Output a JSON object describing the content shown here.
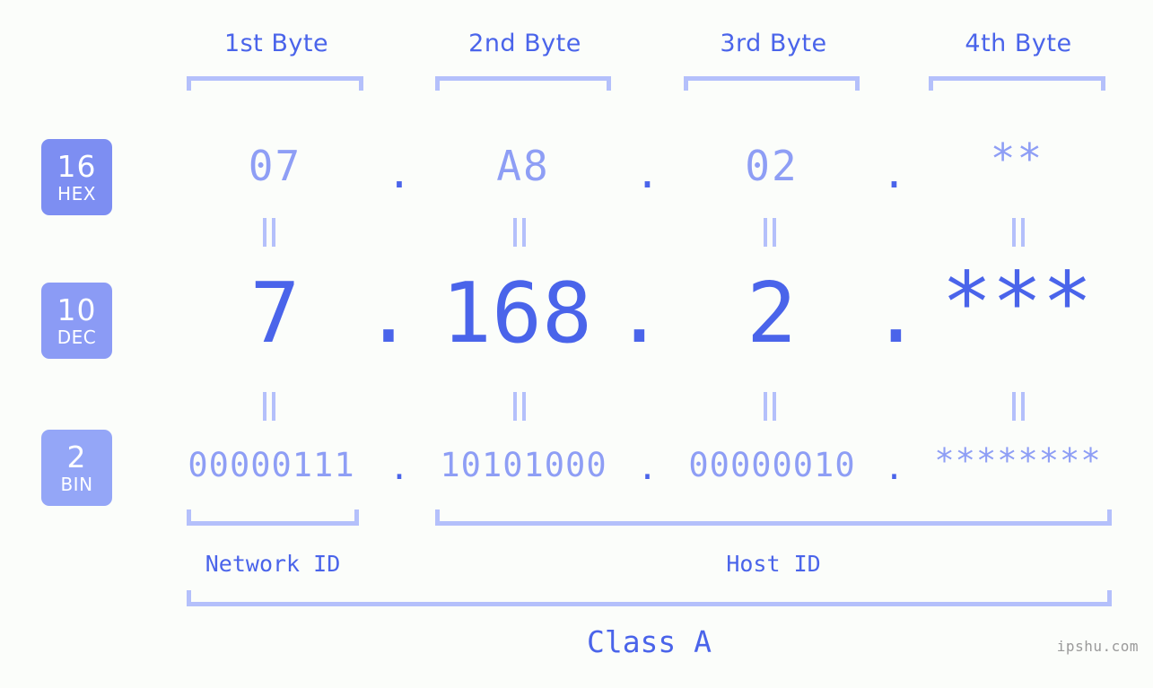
{
  "meta": {
    "background_color": "#fbfdfa",
    "accent_color": "#4a64ea",
    "accent_light_color": "#8e9ef5",
    "bracket_color": "#b4c0fb",
    "watermark": "ipshu.com"
  },
  "byte_headers": [
    {
      "label": "1st Byte"
    },
    {
      "label": "2nd Byte"
    },
    {
      "label": "3rd Byte"
    },
    {
      "label": "4th Byte"
    }
  ],
  "bases": [
    {
      "num": "16",
      "unit": "HEX",
      "color": "#7d8ef2"
    },
    {
      "num": "10",
      "unit": "DEC",
      "color": "#8b9bf5"
    },
    {
      "num": "2",
      "unit": "BIN",
      "color": "#94a6f7"
    }
  ],
  "rows": {
    "hex": {
      "name": "HEX",
      "values": [
        "07",
        "A8",
        "02",
        "**"
      ],
      "separator": "."
    },
    "dec": {
      "name": "DEC",
      "values": [
        "7",
        "168",
        "2",
        "***"
      ],
      "separator": "."
    },
    "bin": {
      "name": "BIN",
      "values": [
        "00000111",
        "10101000",
        "00000010",
        "********"
      ],
      "separator": "."
    }
  },
  "equals_symbol": "=",
  "sections": [
    {
      "label": "Network ID"
    },
    {
      "label": "Host ID"
    }
  ],
  "class": {
    "label": "Class A"
  }
}
